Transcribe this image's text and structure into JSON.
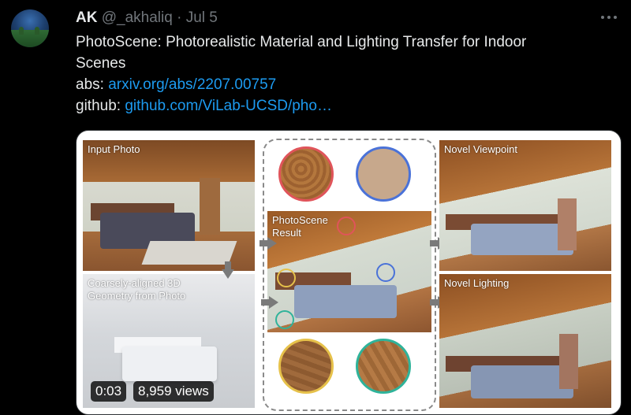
{
  "tweet": {
    "author_name": "AK",
    "author_handle": "@_akhaliq",
    "separator": "·",
    "date": "Jul 5",
    "text_line1": "PhotoScene: Photorealistic Material and Lighting Transfer for Indoor",
    "text_line2": "Scenes",
    "abs_label": "abs:",
    "abs_link": "arxiv.org/abs/2207.00757",
    "github_label": "github:",
    "github_link": "github.com/ViLab-UCSD/pho…"
  },
  "media": {
    "panels": {
      "input_photo": "Input Photo",
      "geometry_line1": "Coarsely-aligned 3D",
      "geometry_line2": "Geometry from Photo",
      "result_line1": "PhotoScene",
      "result_line2": "Result",
      "novel_viewpoint": "Novel Viewpoint",
      "novel_lighting": "Novel Lighting"
    },
    "video_time": "0:03",
    "view_count": "8,959 views"
  },
  "colors": {
    "link": "#1d9bf0",
    "circle_red": "#e0545a",
    "circle_blue": "#4a72d8",
    "circle_yellow": "#e6c14a",
    "circle_teal": "#2fb39a"
  },
  "icons": [
    "more-options-icon",
    "avatar"
  ]
}
